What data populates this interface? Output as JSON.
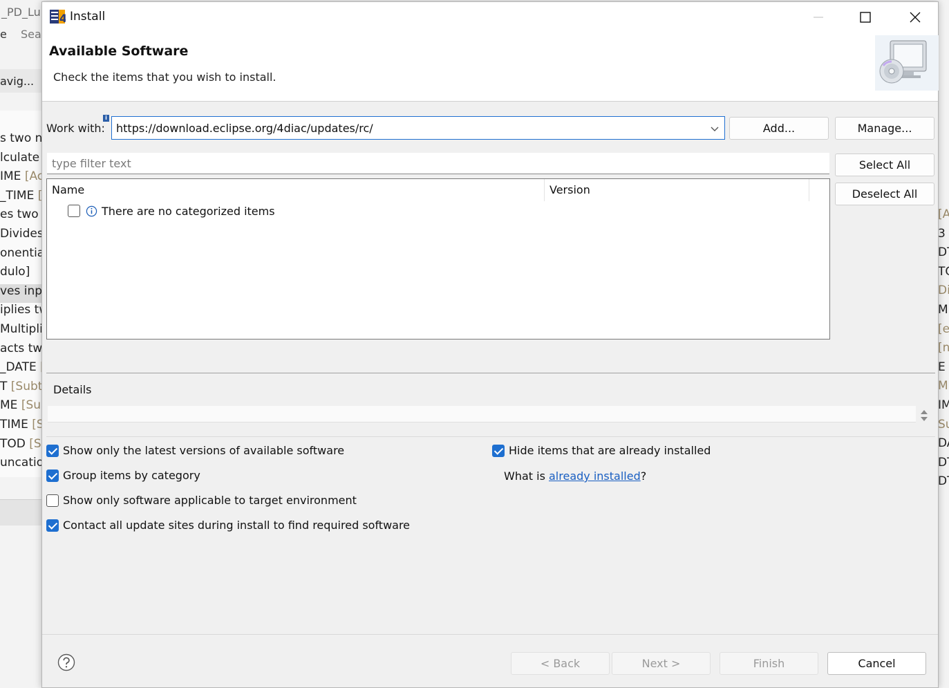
{
  "background": {
    "left_title": "_PD_Lup",
    "left_menu": [
      "e",
      "Sea"
    ],
    "left_nav": "avig...",
    "left_rows": [
      {
        "dark": "s two nu",
        "gray": ""
      },
      {
        "dark": "lculate",
        "gray": ""
      },
      {
        "dark": "IME ",
        "gray": "[Ac"
      },
      {
        "dark": "_TIME ",
        "gray": "[A"
      },
      {
        "dark": "es two v",
        "gray": ""
      },
      {
        "dark": "Divides ",
        "gray": ""
      },
      {
        "dark": "onentiat",
        "gray": ""
      },
      {
        "dark": "dulo]",
        "gray": ""
      },
      {
        "dark": "ves inpu",
        "gray": ""
      },
      {
        "dark": "iplies tw",
        "gray": ""
      },
      {
        "dark": "Multipli",
        "gray": ""
      },
      {
        "dark": "acts two",
        "gray": ""
      },
      {
        "dark": "_DATE ",
        "gray": "["
      },
      {
        "dark": "T ",
        "gray": "[Subtr"
      },
      {
        "dark": "ME ",
        "gray": "[Sub"
      },
      {
        "dark": "TIME ",
        "gray": "[S"
      },
      {
        "dark": "TOD ",
        "gray": "[Su"
      },
      {
        "dark": "uncation",
        "gray": ""
      }
    ],
    "right_rows": [
      {
        "dark": "",
        "gray": "[A"
      },
      {
        "dark": "3",
        "gray": ""
      },
      {
        "dark": "DT",
        "gray": ""
      },
      {
        "dark": "TO",
        "gray": ""
      },
      {
        "dark": "",
        "gray": "Div"
      },
      {
        "dark": "MI",
        "gray": ""
      },
      {
        "dark": "",
        "gray": "[e"
      },
      {
        "dark": "",
        "gray": "[n"
      },
      {
        "dark": "E [",
        "gray": ""
      },
      {
        "dark": "",
        "gray": "M"
      },
      {
        "dark": "IM",
        "gray": ""
      },
      {
        "dark": "",
        "gray": "Su"
      },
      {
        "dark": "DA",
        "gray": ""
      },
      {
        "dark": "DT",
        "gray": ""
      },
      {
        "dark": "DT",
        "gray": ""
      }
    ]
  },
  "window": {
    "title": "Install"
  },
  "header": {
    "title": "Available Software",
    "description": "Check the items that you wish to install."
  },
  "work_with": {
    "label": "Work with:",
    "value": "https://download.eclipse.org/4diac/updates/rc/",
    "info_marker": "i",
    "add_label": "Add...",
    "manage_label": "Manage..."
  },
  "filter": {
    "placeholder": "type filter text"
  },
  "buttons": {
    "select_all": "Select All",
    "deselect_all": "Deselect All"
  },
  "table": {
    "columns": [
      "Name",
      "Version"
    ],
    "rows": [
      {
        "name": "There are no categorized items",
        "checked": false
      }
    ]
  },
  "details": {
    "label": "Details",
    "text": ""
  },
  "options": {
    "show_latest": {
      "label": "Show only the latest versions of available software",
      "checked": true
    },
    "group_by_category": {
      "label": "Group items by category",
      "checked": true
    },
    "target_env": {
      "label": "Show only software applicable to target environment",
      "checked": false
    },
    "contact_sites": {
      "label": "Contact all update sites during install to find required software",
      "checked": true
    },
    "hide_installed": {
      "label": "Hide items that are already installed",
      "checked": true
    },
    "what_is_prefix": "What is ",
    "already_installed_link": "already installed",
    "what_is_suffix": "?"
  },
  "footer": {
    "back": "< Back",
    "next": "Next >",
    "finish": "Finish",
    "cancel": "Cancel"
  },
  "colors": {
    "accent": "#1e6fd0",
    "link": "#1a5fc2"
  },
  "icons": {
    "app": "eclipse-4diac-icon",
    "banner": "computer-cd-icon",
    "help": "help-icon",
    "info": "info-icon"
  }
}
